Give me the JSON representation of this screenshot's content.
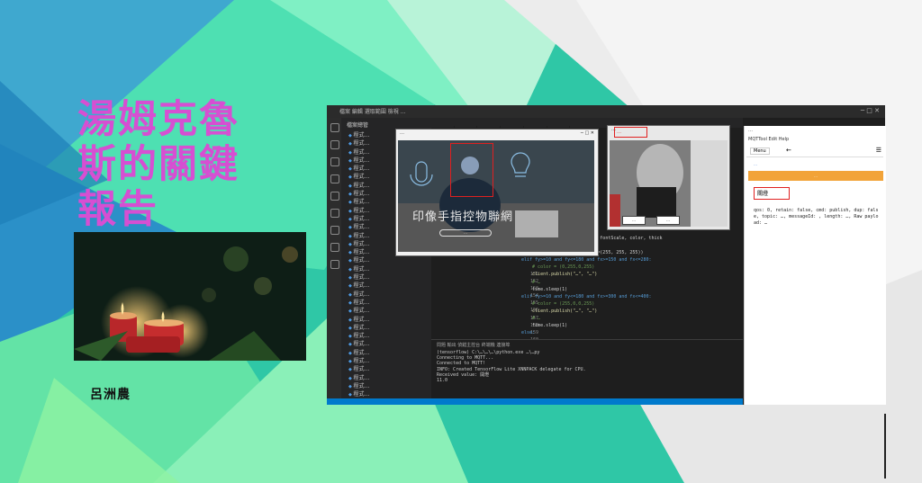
{
  "slide": {
    "title": "湯姆克魯斯的關鍵報告",
    "author": "呂洲農"
  },
  "screenshot": {
    "vscode_menu": "檔案  編輯  選取範圍  檢視  …",
    "vscode_window_controls": "─  □  ✕",
    "explorer_header": "檔案總管",
    "explorer_files": [
      "程式…",
      "程式…",
      "程式…",
      "程式…",
      "程式…",
      "程式…",
      "程式…",
      "程式…",
      "程式…",
      "程式…",
      "程式…",
      "程式…",
      "程式…",
      "程式…",
      "程式…",
      "程式…",
      "程式…",
      "程式…",
      "程式…",
      "程式…",
      "程式…",
      "程式…",
      "程式…",
      "程式…",
      "程式…",
      "程式…",
      "程式…",
      "程式…",
      "程式…",
      "程式…",
      "程式…",
      "程式…",
      "程式…",
      "程式…",
      "程式…",
      "程式…",
      "程式…",
      "程式…",
      "程式…"
    ],
    "editor_tabs": [
      "….py",
      "….py",
      "….py",
      "….py",
      "….py",
      "….py"
    ],
    "code_lines": [
      {
        "text": "… 'hoice system', org, font, fontScale, color, thick",
        "cls": ""
      },
      {
        "text": "",
        "cls": ""
      },
      {
        "text": "… (-10, (255, 0, 255)), fill=(255, 255, 255))",
        "cls": ""
      },
      {
        "text": "elif fy>=10 and fy<=180 and fx>=150 and fx<=280:",
        "cls": "bl"
      },
      {
        "text": "    # color = (0,255,0,255)",
        "cls": "gr"
      },
      {
        "text": "    client.publish(\"…\", \"…\")",
        "cls": "yl"
      },
      {
        "text": "    # …",
        "cls": "gr"
      },
      {
        "text": "    time.sleep(1)",
        "cls": ""
      },
      {
        "text": "elif fy>=10 and fy<=180 and fx>=300 and fx<=400:",
        "cls": "bl"
      },
      {
        "text": "    # color = (255,0,0,255)",
        "cls": "gr"
      },
      {
        "text": "    client.publish(\"…\", \"…\")",
        "cls": "yl"
      },
      {
        "text": "    # …",
        "cls": "gr"
      },
      {
        "text": "    time.sleep(1)",
        "cls": ""
      },
      {
        "text": "else:",
        "cls": "bl"
      }
    ],
    "line_numbers": "151\n152\n153\n154\n155\n156\n157\n158\n159\n160\n161\n162\n163\n164\n165\n166\n167",
    "terminal_tabs": "問題   輸出   偵錯主控台   終端機   連接埠",
    "terminal_lines": [
      "(tensorflow) C:\\…\\…\\…\\python.exe …\\…py",
      "Connecting to MQTT...",
      "Connected to MQTT!",
      "INFO: Created TensorFlow Lite XNNPACK delegate for CPU.",
      "Received value: 開燈",
      "11.0"
    ],
    "status_text": "",
    "win1_title": "…",
    "win1_app_title": "印像手指控物聯網",
    "win1_button": "…",
    "win2_title": "…",
    "win2_label": "…",
    "win2_btn1": "…",
    "win2_btn2": "…",
    "mqtt": {
      "top_title": "…",
      "top_nav": "MQTTool  Edit  Help",
      "menu_label": "Menu",
      "back_arrow": "←",
      "hamburger": "☰",
      "url": "…",
      "orange_button": "…",
      "message_box": "關燈",
      "payload": "qos: 0, retain: false, cmd: publish, dup: false, topic: …, messageId: , length: …, Raw payload: …"
    }
  }
}
